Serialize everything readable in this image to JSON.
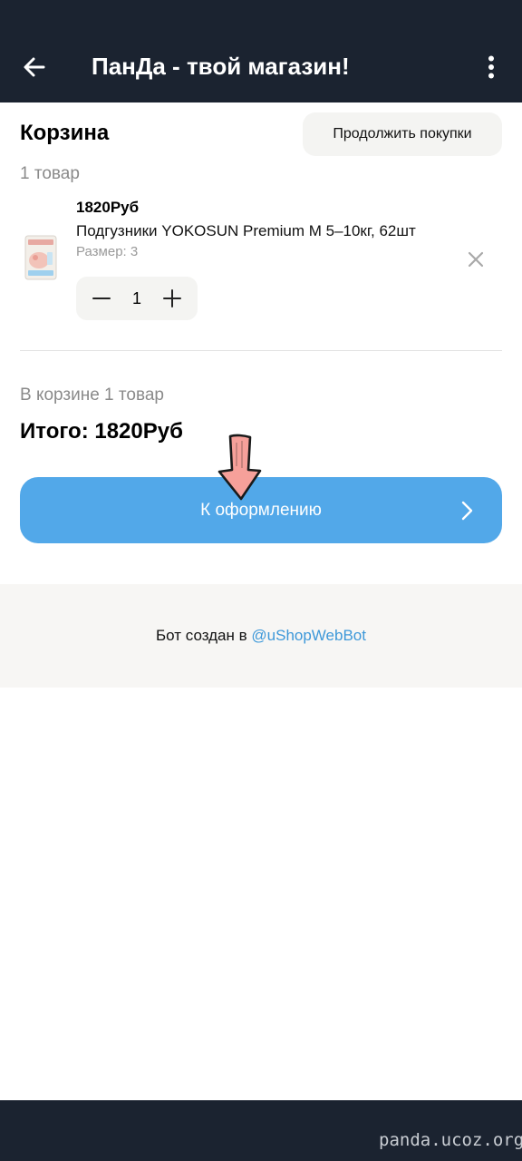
{
  "header": {
    "title": "ПанДа - твой магазин!",
    "back_icon": "arrow-left-icon",
    "menu_icon": "more-vertical-icon"
  },
  "cart": {
    "title": "Корзина",
    "continue_label": "Продолжить покупки",
    "items_count": "1 товар"
  },
  "item": {
    "price": "1820Руб",
    "name": "Подгузники YOKOSUN Premium M 5–10кг, 62шт",
    "size": "Размер: 3",
    "quantity": "1",
    "remove_icon": "close-icon",
    "minus_icon": "minus-icon",
    "plus_icon": "plus-icon"
  },
  "summary": {
    "count": "В корзине 1 товар",
    "total": "Итого: 1820Руб"
  },
  "checkout": {
    "label": "К оформлению",
    "icon": "chevron-right-icon"
  },
  "footer": {
    "text": "Бот создан в ",
    "link": "@uShopWebBot"
  },
  "watermark": "panda.ucoz.org",
  "colors": {
    "header_bg": "#1b2330",
    "accent": "#52a8e9",
    "link": "#3d98d9",
    "pointer_arrow": "#f6a09a"
  }
}
